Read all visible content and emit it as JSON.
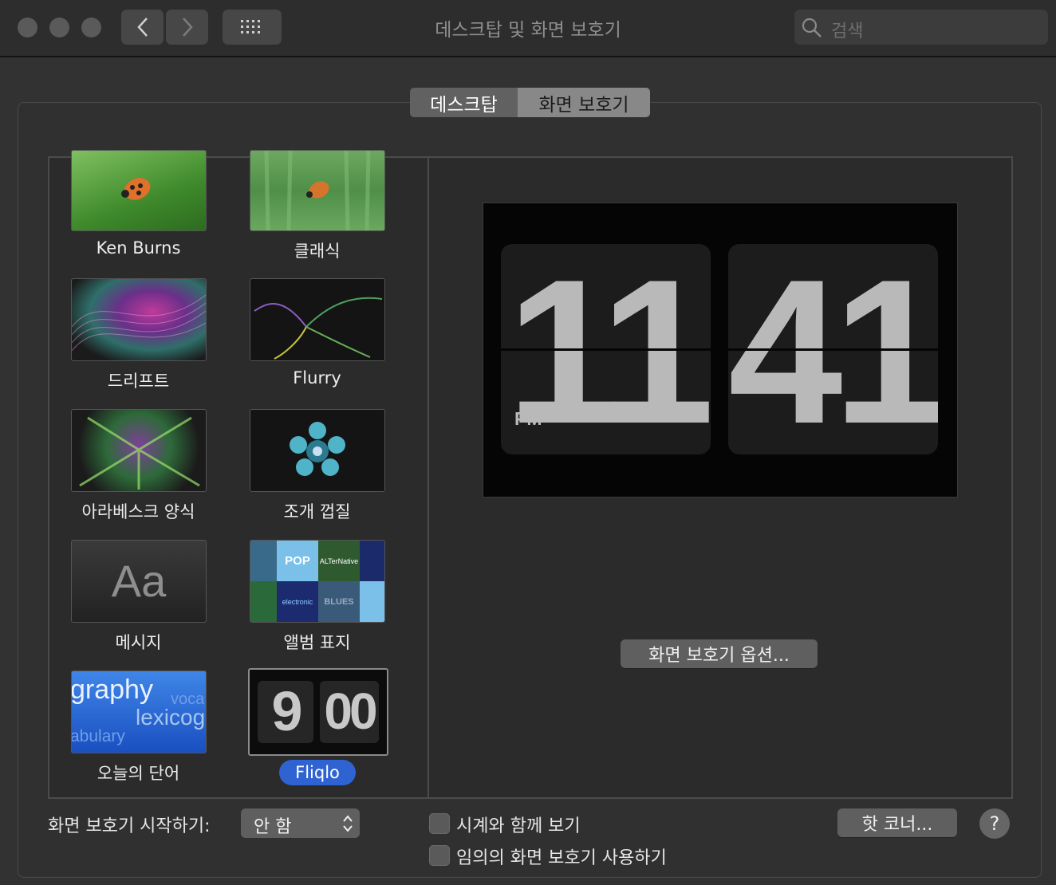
{
  "window": {
    "title": "데스크탑 및 화면 보호기",
    "search_placeholder": "검색"
  },
  "tabs": [
    {
      "label": "데스크탑",
      "selected": false
    },
    {
      "label": "화면 보호기",
      "selected": true
    }
  ],
  "savers": [
    {
      "label": "Ken Burns"
    },
    {
      "label": "클래식"
    },
    {
      "label": "드리프트"
    },
    {
      "label": "Flurry"
    },
    {
      "label": "아라베스크 양식"
    },
    {
      "label": "조개 껍질"
    },
    {
      "label": "메시지"
    },
    {
      "label": "앨범 표지"
    },
    {
      "label": "오늘의 단어"
    },
    {
      "label": "Fliqlo",
      "selected": true
    }
  ],
  "thumb_text": {
    "message_aa": "Aa",
    "word_graphy": "graphy",
    "word_voca": "voca",
    "word_lexicog": "lexicog",
    "word_abulary": "abulary",
    "fliqlo_hour": "9",
    "fliqlo_min": "00",
    "album_pop": "POP",
    "album_blues": "BLUES",
    "album_alt": "ALTerNative",
    "album_elec": "electronic"
  },
  "preview": {
    "hour": "11",
    "minute": "41",
    "ampm": "PM"
  },
  "options_button": "화면 보호기 옵션...",
  "start_label": "화면 보호기 시작하기:",
  "start_value": "안 함",
  "show_clock_label": "시계와 함께 보기",
  "random_label": "임의의 화면 보호기 사용하기",
  "hot_corners_button": "핫 코너...",
  "help_label": "?"
}
